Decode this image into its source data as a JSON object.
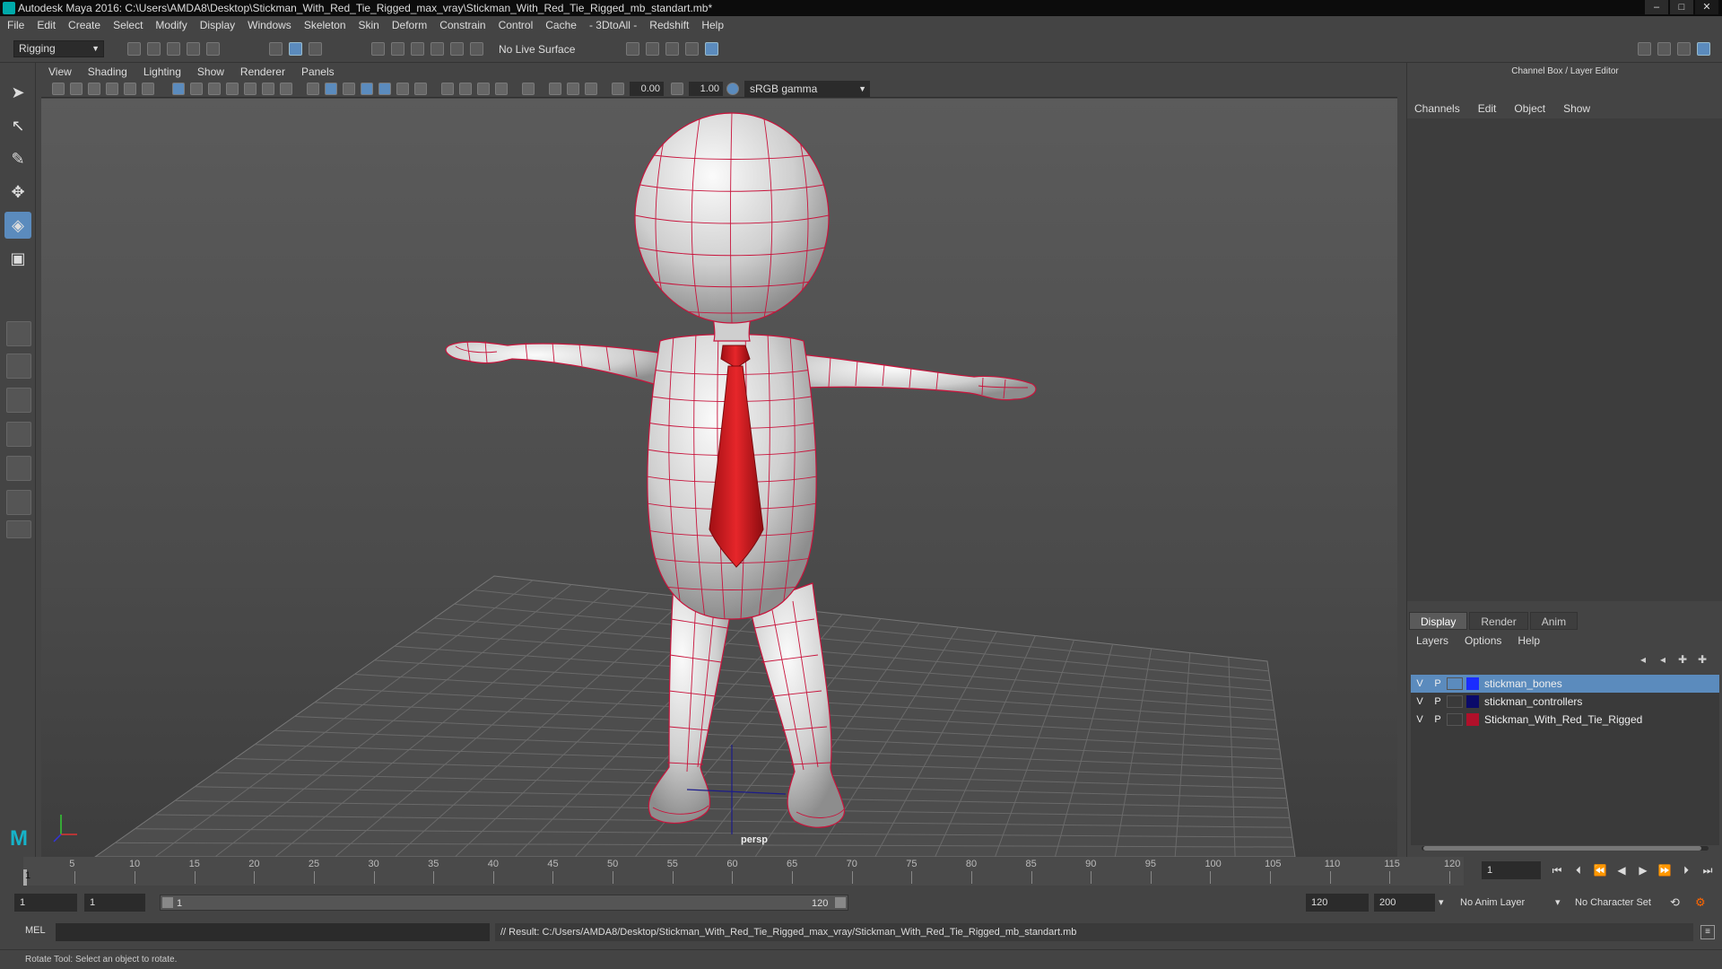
{
  "window": {
    "title": "Autodesk Maya 2016: C:\\Users\\AMDA8\\Desktop\\Stickman_With_Red_Tie_Rigged_max_vray\\Stickman_With_Red_Tie_Rigged_mb_standart.mb*",
    "minimize": "–",
    "maximize": "□",
    "close": "✕"
  },
  "menubar": [
    "File",
    "Edit",
    "Create",
    "Select",
    "Modify",
    "Display",
    "Windows",
    "Skeleton",
    "Skin",
    "Deform",
    "Constrain",
    "Control",
    "Cache",
    "- 3DtoAll -",
    "Redshift",
    "Help"
  ],
  "toolbar": {
    "mode": "Rigging",
    "live_surface": "No Live Surface"
  },
  "panel_menu": [
    "View",
    "Shading",
    "Lighting",
    "Show",
    "Renderer",
    "Panels"
  ],
  "panel_toolbar": {
    "exposure": "0.00",
    "gamma": "1.00",
    "color_space": "sRGB gamma"
  },
  "viewport": {
    "camera": "persp",
    "wire_color": "#c8143c",
    "tie_color": "#d81e1e"
  },
  "channel_box": {
    "title": "Channel Box / Layer Editor",
    "menu": [
      "Channels",
      "Edit",
      "Object",
      "Show"
    ]
  },
  "layer_editor": {
    "tabs": [
      "Display",
      "Render",
      "Anim"
    ],
    "active_tab": "Display",
    "menu": [
      "Layers",
      "Options",
      "Help"
    ],
    "layers": [
      {
        "v": "V",
        "p": "P",
        "name": "stickman_bones",
        "color": "#1a2cff",
        "selected": true
      },
      {
        "v": "V",
        "p": "P",
        "name": "stickman_controllers",
        "color": "#0a0a6a",
        "selected": false
      },
      {
        "v": "V",
        "p": "P",
        "name": "Stickman_With_Red_Tie_Rigged",
        "color": "#b0102a",
        "selected": false
      }
    ]
  },
  "timeline": {
    "ticks": [
      "5",
      "10",
      "15",
      "20",
      "25",
      "30",
      "35",
      "40",
      "45",
      "50",
      "55",
      "60",
      "65",
      "70",
      "75",
      "80",
      "85",
      "90",
      "95",
      "100",
      "105",
      "110",
      "115",
      "120"
    ],
    "current_frame": "1",
    "current_frame_field": "1",
    "end": 120
  },
  "range": {
    "start": "1",
    "playback_start": "1",
    "range_start_label": "1",
    "range_end_label": "120",
    "playback_end": "120",
    "anim_end": "200",
    "anim_layer": "No Anim Layer",
    "character_set": "No Character Set"
  },
  "command": {
    "language": "MEL",
    "result": "// Result: C:/Users/AMDA8/Desktop/Stickman_With_Red_Tie_Rigged_max_vray/Stickman_With_Red_Tie_Rigged_mb_standart.mb"
  },
  "help_line": "Rotate Tool: Select an object to rotate."
}
